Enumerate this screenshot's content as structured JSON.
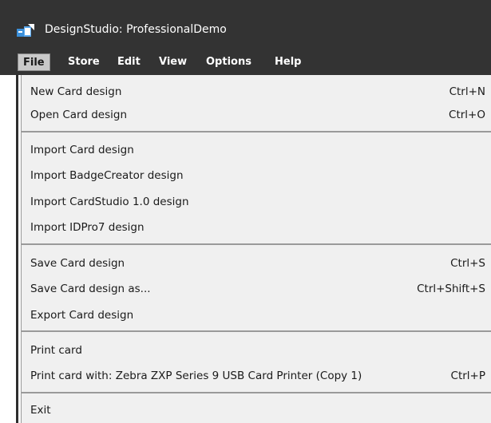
{
  "window": {
    "title": "DesignStudio: ProfessionalDemo",
    "icon": "designstudio-app-icon"
  },
  "menubar": {
    "items": [
      {
        "label": "File",
        "active": true
      },
      {
        "label": "Store"
      },
      {
        "label": "Edit"
      },
      {
        "label": "View"
      },
      {
        "label": "Options"
      },
      {
        "label": "Help"
      }
    ]
  },
  "file_menu": {
    "items": [
      {
        "label": "New Card design",
        "shortcut": "Ctrl+N"
      },
      {
        "label": "Open Card design",
        "shortcut": "Ctrl+O"
      },
      {
        "label": "Import Card design",
        "shortcut": ""
      },
      {
        "label": "Import BadgeCreator design",
        "shortcut": ""
      },
      {
        "label": "Import CardStudio 1.0 design",
        "shortcut": ""
      },
      {
        "label": "Import IDPro7 design",
        "shortcut": ""
      },
      {
        "label": "Save Card design",
        "shortcut": "Ctrl+S"
      },
      {
        "label": "Save Card design as...",
        "shortcut": "Ctrl+Shift+S"
      },
      {
        "label": "Export Card design",
        "shortcut": ""
      },
      {
        "label": "Print card",
        "shortcut": ""
      },
      {
        "label": "Print card with: Zebra ZXP Series 9 USB Card Printer (Copy 1)",
        "shortcut": "Ctrl+P"
      },
      {
        "label": "Exit",
        "shortcut": ""
      }
    ]
  },
  "colors": {
    "titlebar": "#333333",
    "menu_background": "#f0f0f0",
    "separator": "#9a9a9a",
    "icon_blue": "#3b8fd9"
  }
}
